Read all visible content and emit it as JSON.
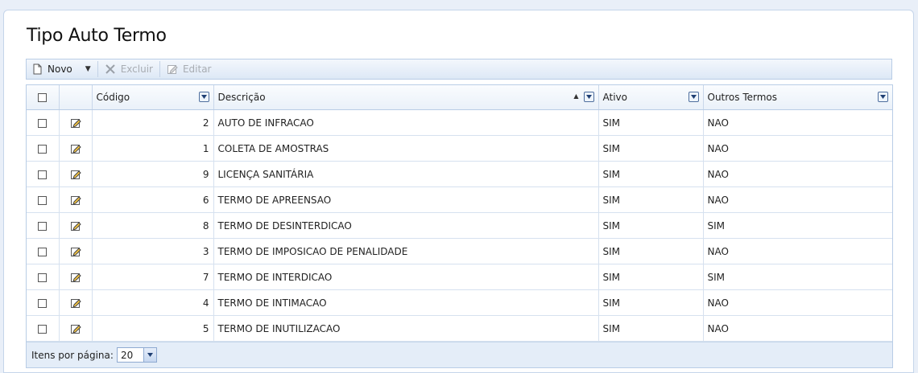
{
  "page": {
    "title": "Tipo Auto Termo"
  },
  "toolbar": {
    "new_label": "Novo",
    "delete_label": "Excluir",
    "edit_label": "Editar"
  },
  "grid": {
    "columns": {
      "code": "Código",
      "description": "Descrição",
      "active": "Ativo",
      "other_terms": "Outros Termos"
    },
    "rows": [
      {
        "code": "2",
        "description": "AUTO DE INFRACAO",
        "active": "SIM",
        "other_terms": "NAO"
      },
      {
        "code": "1",
        "description": "COLETA DE AMOSTRAS",
        "active": "SIM",
        "other_terms": "NAO"
      },
      {
        "code": "9",
        "description": "LICENÇA SANITÁRIA",
        "active": "SIM",
        "other_terms": "NAO"
      },
      {
        "code": "6",
        "description": "TERMO DE APREENSAO",
        "active": "SIM",
        "other_terms": "NAO"
      },
      {
        "code": "8",
        "description": "TERMO DE DESINTERDICAO",
        "active": "SIM",
        "other_terms": "SIM"
      },
      {
        "code": "3",
        "description": "TERMO DE IMPOSICAO DE PENALIDADE",
        "active": "SIM",
        "other_terms": "NAO"
      },
      {
        "code": "7",
        "description": "TERMO DE INTERDICAO",
        "active": "SIM",
        "other_terms": "SIM"
      },
      {
        "code": "4",
        "description": "TERMO DE INTIMACAO",
        "active": "SIM",
        "other_terms": "NAO"
      },
      {
        "code": "5",
        "description": "TERMO DE INUTILIZACAO",
        "active": "SIM",
        "other_terms": "NAO"
      }
    ]
  },
  "footer": {
    "page_size_label": "Itens por página:",
    "page_size_value": "20"
  },
  "icons": {
    "new": "new-document-icon",
    "delete": "x-icon",
    "edit": "pencil-icon",
    "row_edit": "edit-icon"
  }
}
